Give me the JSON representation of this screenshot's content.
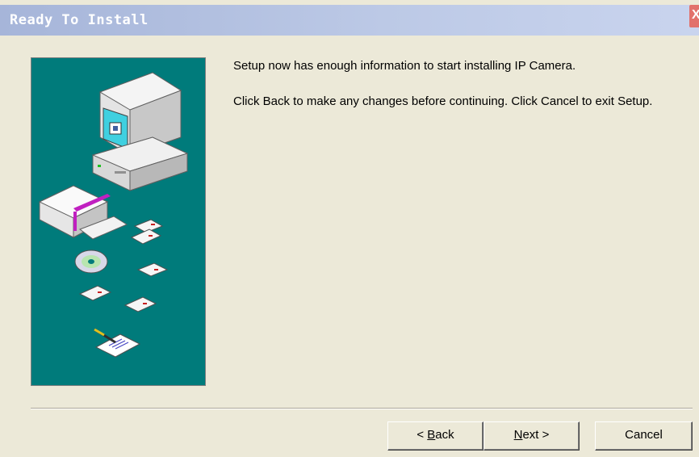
{
  "window": {
    "title": "Ready To Install",
    "close_glyph": "X"
  },
  "content": {
    "line1": "Setup now has enough information to start installing IP Camera.",
    "line2": "Click Back to make any changes before continuing. Click Cancel to exit Setup."
  },
  "buttons": {
    "back": {
      "prefix": "< ",
      "accel": "B",
      "rest": "ack"
    },
    "next": {
      "prefix": "",
      "accel": "N",
      "rest": "ext >"
    },
    "cancel": {
      "label": "Cancel"
    }
  },
  "colors": {
    "art_background": "#007b7b",
    "dialog_face": "#ece9d8",
    "titlebar": "#a6b5d9"
  },
  "icons": {
    "illustration": "computer-disks-cd-illustration",
    "close": "close-icon"
  }
}
